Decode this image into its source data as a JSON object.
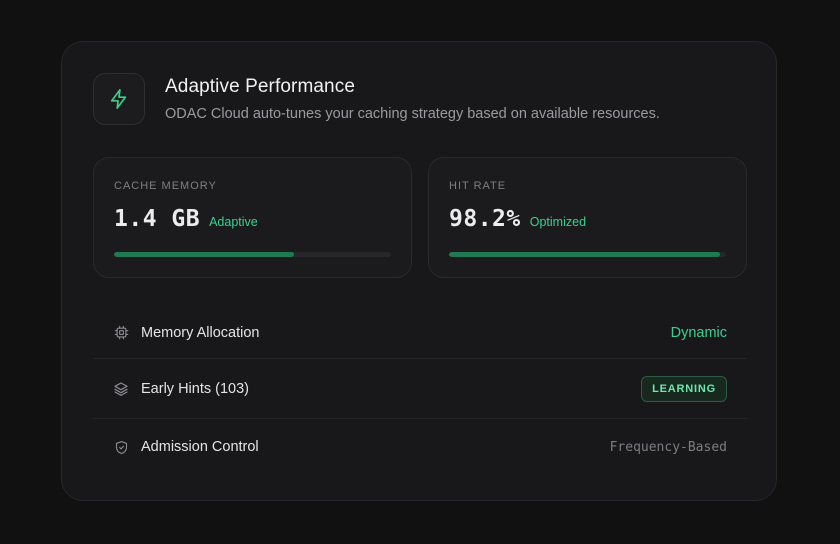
{
  "header": {
    "icon": "lightning-bolt-icon",
    "title": "Adaptive Performance",
    "subtitle": "ODAC Cloud auto-tunes your caching strategy based on available resources."
  },
  "metrics": [
    {
      "label": "CACHE MEMORY",
      "value": "1.4 GB",
      "badge": "Adaptive",
      "progress_percent": 65
    },
    {
      "label": "HIT RATE",
      "value": "98.2%",
      "badge": "Optimized",
      "progress_percent": 98
    }
  ],
  "rows": [
    {
      "icon": "chip-icon",
      "label": "Memory Allocation",
      "value": "Dynamic"
    },
    {
      "icon": "layers-icon",
      "label": "Early Hints (103)",
      "value": "LEARNING"
    },
    {
      "icon": "shield-icon",
      "label": "Admission Control",
      "value": "Frequency-Based"
    }
  ],
  "colors": {
    "accent": "#3ecf8e",
    "bar_fill": "#1f7a52",
    "card_bg": "#18181a",
    "page_bg": "#111112"
  }
}
